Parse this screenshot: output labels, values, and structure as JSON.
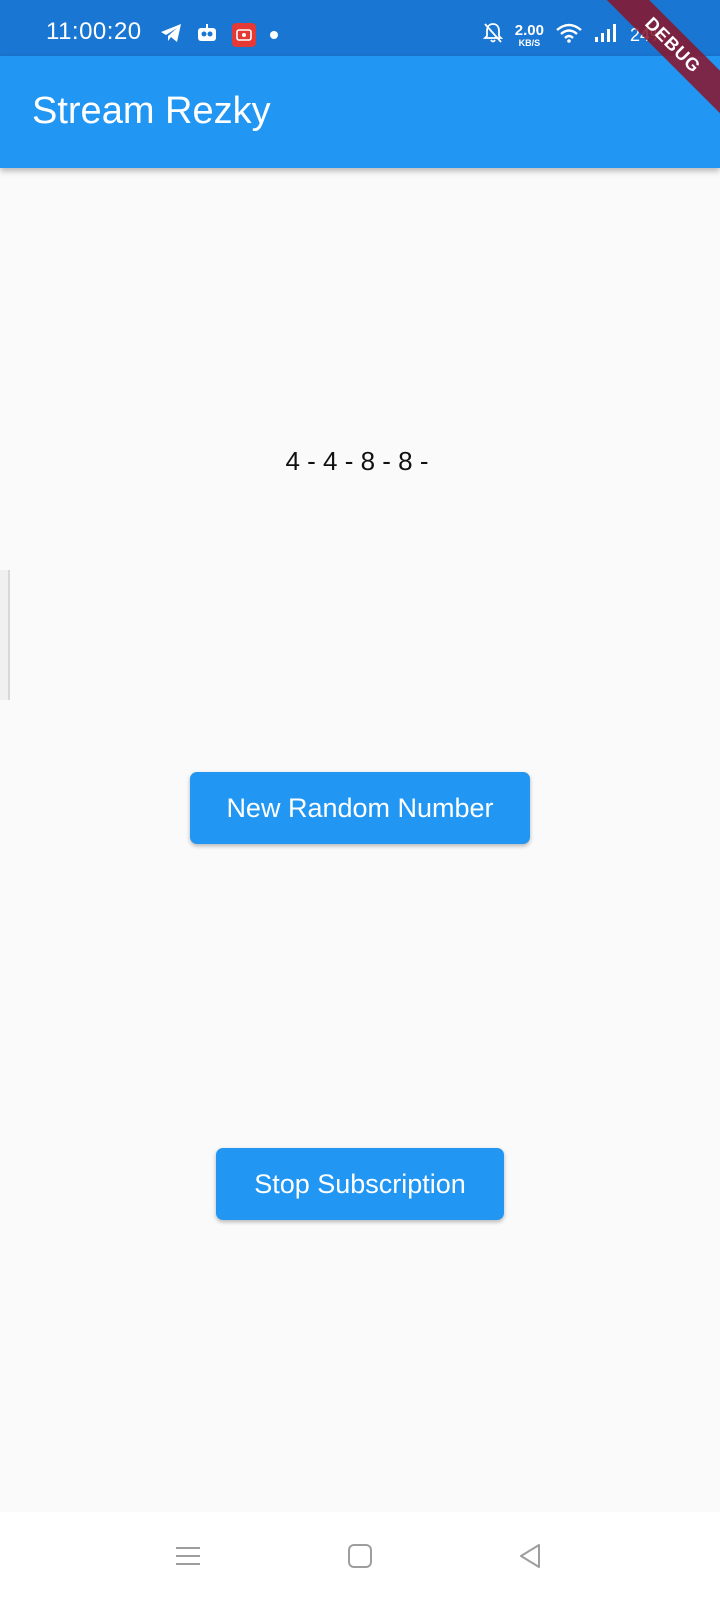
{
  "status_bar": {
    "time": "11:00:20",
    "net_speed_value": "2.00",
    "net_speed_unit": "KB/S",
    "battery": "24%",
    "icons": [
      "telegram-icon",
      "bot-icon",
      "screen-record-icon",
      "notification-dot-icon",
      "bell-off-icon",
      "wifi-icon",
      "signal-icon"
    ]
  },
  "debug_banner": "DEBUG",
  "app_bar": {
    "title": "Stream Rezky"
  },
  "content": {
    "stream_values": "4 - 4 - 8 - 8 -"
  },
  "buttons": {
    "new_random": "New Random Number",
    "stop_subscription": "Stop Subscription"
  },
  "nav_bar": {
    "icons": [
      "menu-icon",
      "home-icon",
      "back-icon"
    ]
  },
  "colors": {
    "status_bar": "#1976d2",
    "app_bar": "#2196f3",
    "button": "#2196f3",
    "background": "#fafafa",
    "debug_ribbon": "#8c1428"
  }
}
